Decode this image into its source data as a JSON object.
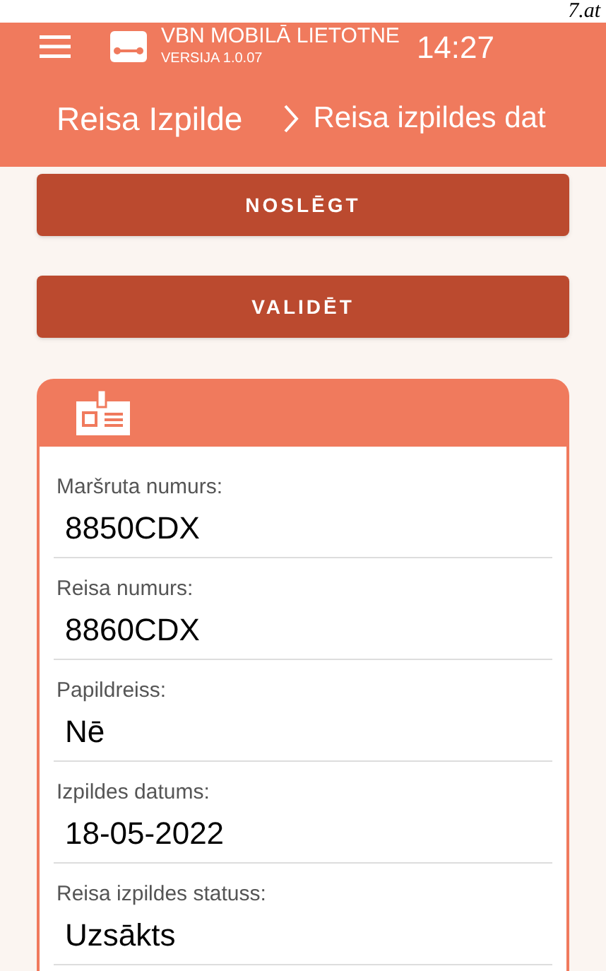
{
  "top_fragment": "7.at",
  "header": {
    "app_title": "VBN MOBILĀ LIETOTNE",
    "version": "VERSIJA 1.0.07",
    "time": "14:27"
  },
  "breadcrumb": [
    {
      "label": "Reisa Izpilde"
    },
    {
      "label": "Reisa izpildes dat"
    }
  ],
  "buttons": [
    "NOSLĒGT",
    "VALIDĒT"
  ],
  "fields": [
    {
      "label": "Maršruta numurs:",
      "value": "8850CDX"
    },
    {
      "label": "Reisa numurs:",
      "value": "8860CDX"
    },
    {
      "label": "Papildreiss:",
      "value": "Nē"
    },
    {
      "label": "Izpildes datums:",
      "value": "18-05-2022"
    },
    {
      "label": "Reisa izpildes statuss:",
      "value": "Uzsākts"
    }
  ]
}
